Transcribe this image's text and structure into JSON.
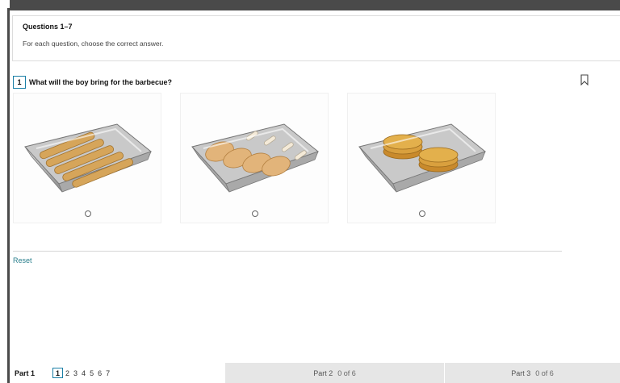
{
  "instructions": {
    "title": "Questions 1–7",
    "text": "For each question, choose the correct answer."
  },
  "question": {
    "number": "1",
    "text": "What will the boy bring for the barbecue?"
  },
  "options": [
    {
      "icon": "sausages-tray-image"
    },
    {
      "icon": "chicken-legs-tray-image"
    },
    {
      "icon": "burgers-tray-image"
    }
  ],
  "reset_label": "Reset",
  "footer": {
    "part1_label": "Part 1",
    "questions": [
      "1",
      "2",
      "3",
      "4",
      "5",
      "6",
      "7"
    ],
    "part2_label": "Part 2",
    "part2_count": "0 of 6",
    "part3_label": "Part 3",
    "part3_count": "0 of 6"
  },
  "colors": {
    "accent": "#1a7fa6",
    "reset_link": "#2a7f8c",
    "frame": "#4a4a4a"
  }
}
